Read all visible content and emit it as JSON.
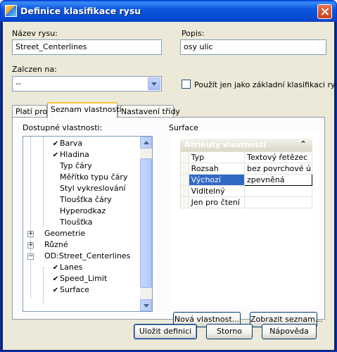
{
  "window": {
    "title": "Definice klasifikace rysu"
  },
  "fields": {
    "name_label": "Název rysu:",
    "name_value": "Street_Centerlines",
    "desc_label": "Popis:",
    "desc_value": "osy ulic",
    "link_label": "Zalczen na:",
    "link_value": "--",
    "base_only_label": "Použít jen jako základní klasifikaci rysu",
    "base_only_checked": false
  },
  "tabs": [
    {
      "label": "Platí pro",
      "active": false
    },
    {
      "label": "Seznam vlastností",
      "active": true
    },
    {
      "label": "Nastavení třídy",
      "active": false
    }
  ],
  "tree": {
    "label": "Dostupné vlastnosti:",
    "items": [
      {
        "label": "Barva",
        "checked": true
      },
      {
        "label": "Hladina",
        "checked": true
      },
      {
        "label": "Typ čáry",
        "checked": false
      },
      {
        "label": "Měřítko typu čáry",
        "checked": false
      },
      {
        "label": "Styl vykreslování",
        "checked": false
      },
      {
        "label": "Tloušťka čáry",
        "checked": false
      },
      {
        "label": "Hyperodkaz",
        "checked": false
      },
      {
        "label": "Tloušťka",
        "checked": false
      },
      {
        "label": "Geometrie",
        "group": true,
        "expanded": false
      },
      {
        "label": "Různé",
        "group": true,
        "expanded": false
      },
      {
        "label": "OD:Street_Centerlines",
        "group": true,
        "expanded": true
      },
      {
        "label": "Lanes",
        "checked": true
      },
      {
        "label": "Speed_Limit",
        "checked": true
      },
      {
        "label": "Surface",
        "checked": true,
        "selected": true
      }
    ]
  },
  "properties": {
    "selected_label": "Surface",
    "header": "Atributy vlastností",
    "rows": [
      {
        "name": "Typ",
        "value": "Textový řetězec"
      },
      {
        "name": "Rozsah",
        "value": "bez povrchové úp..."
      },
      {
        "name": "Výchozí",
        "value": "zpevněná",
        "selected": true
      },
      {
        "name": "Viditelný",
        "value": ""
      },
      {
        "name": "Jen pro čtení",
        "value": ""
      }
    ]
  },
  "buttons": {
    "new_property": "Nová vlastnost...",
    "show_list": "Zobrazit seznam...",
    "save": "Uložit definici",
    "cancel": "Storno",
    "help": "Nápověda"
  }
}
